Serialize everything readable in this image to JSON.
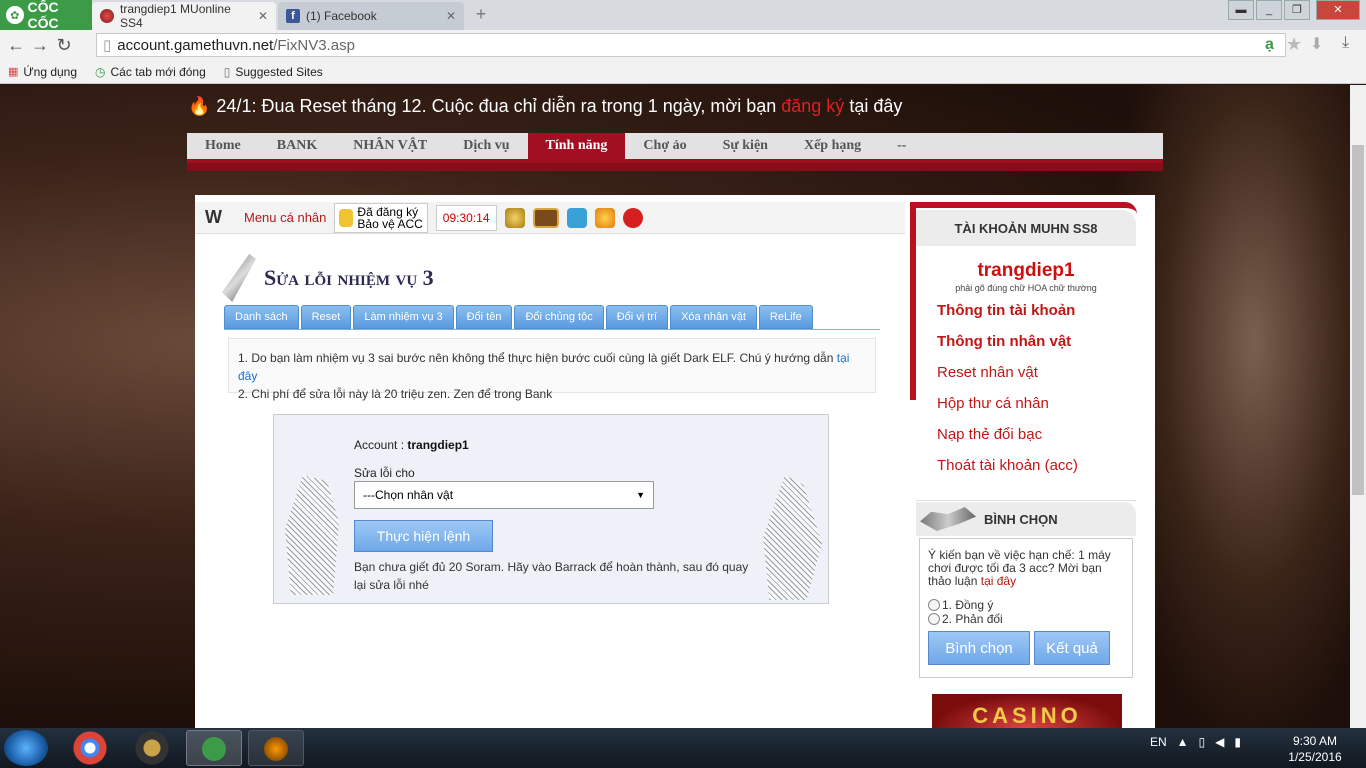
{
  "browser": {
    "logo": "CỐC CỐC",
    "tabs": [
      {
        "title": "trangdiep1 MUonline SS4"
      },
      {
        "title": "(1) Facebook"
      }
    ],
    "new_tab": "+",
    "url_host": "account.gamethuvn.net",
    "url_path": "/FixNV3.asp",
    "bookmarks": [
      "Ứng dụng",
      "Các tab mới đóng",
      "Suggested Sites"
    ]
  },
  "notice": {
    "text": "24/1: Đua Reset tháng 12. Cuộc đua chỉ diễn ra trong 1 ngày, mời bạn",
    "link": "đăng ký",
    "suffix": "tại đây"
  },
  "menu": [
    "Home",
    "BANK",
    "NHÂN VẬT",
    "Dịch vụ",
    "Tính năng",
    "Chợ ảo",
    "Sự kiện",
    "Xếp hạng",
    "--"
  ],
  "menu_active": "Tính năng",
  "toolbar": {
    "menu_label": "Menu cá nhân",
    "registered_line1": "Đã đăng ký",
    "registered_line2": "Bảo vệ ACC",
    "clock": "09:30:14"
  },
  "page_title": "Sửa lỗi nhiệm vụ 3",
  "subtabs": [
    "Danh sách",
    "Reset",
    "Làm nhiệm vụ 3",
    "Đổi tên",
    "Đổi chủng tộc",
    "Đổi vị trí",
    "Xóa nhân vật",
    "ReLife"
  ],
  "notes": {
    "line1": "1. Do bạn làm nhiệm vụ 3 sai bước nên không thể thực hiện bước cuối cùng là giết Dark ELF. Chú ý hướng dẫn",
    "line1_link": "tại đây",
    "line2": "2. Chi phí để sửa lỗi này là 20 triệu zen. Zen để trong Bank"
  },
  "form": {
    "account_label": "Account :",
    "account_value": "trangdiep1",
    "fix_for_label": "Sửa lỗi cho",
    "select_value": "---Chọn nhân vật",
    "submit": "Thực hiện lệnh",
    "message": "Bạn chưa giết đủ 20 Soram. Hãy vào Barrack để hoàn thành, sau đó quay lại sửa lỗi nhé"
  },
  "account_panel": {
    "title": "TÀI KHOẢN MUHN SS8",
    "username": "trangdiep1",
    "hint": "phải gõ đúng chữ HOA chữ thường",
    "links": [
      "Thông tin tài khoản",
      "Thông tin nhân vật",
      "Reset nhân vật",
      "Hộp thư cá nhân",
      "Nạp thẻ đổi bạc",
      "Thoát tài khoản (acc)"
    ]
  },
  "poll": {
    "title": "BÌNH CHỌN",
    "question": "Ý kiến bạn về việc hạn chế: 1 máy chơi được tối đa 3 acc? Mời bạn thảo luận",
    "question_link": "tại đây",
    "options": [
      "1. Đồng ý",
      "2. Phản đối"
    ],
    "vote": "Bình chọn",
    "results": "Kết quả"
  },
  "banner": "CASINO",
  "taskbar": {
    "lang": "EN",
    "time": "9:30 AM",
    "date": "1/25/2016"
  },
  "colors": {
    "accent_red": "#a30f22",
    "link_red": "#c21616",
    "tab_blue": "#6fa8e8"
  }
}
